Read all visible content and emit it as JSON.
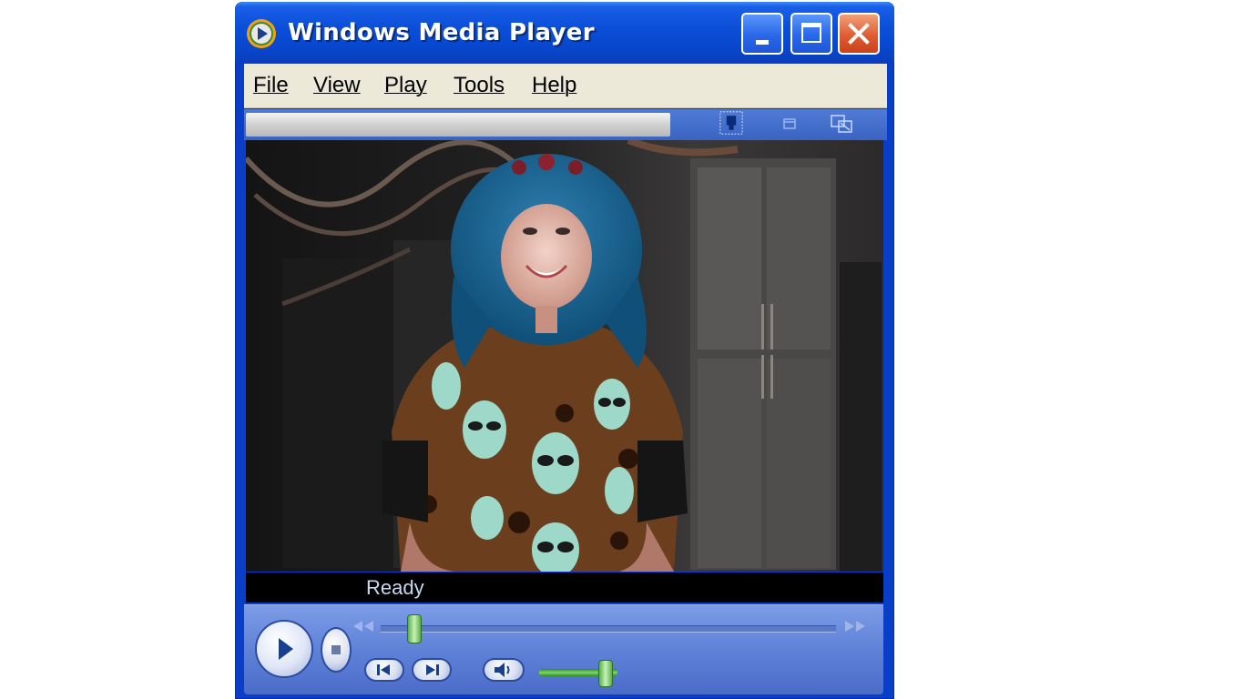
{
  "window": {
    "title": "Windows Media Player"
  },
  "menu": {
    "items": [
      {
        "label": "File"
      },
      {
        "label": "View"
      },
      {
        "label": "Play"
      },
      {
        "label": "Tools"
      },
      {
        "label": "Help"
      }
    ]
  },
  "status": {
    "text": "Ready"
  },
  "playback": {
    "seek_position_fraction": 0.06,
    "volume_fraction": 0.9
  },
  "icons": {
    "app": "wmp-logo-icon",
    "minimize": "minimize-icon",
    "maximize": "maximize-icon",
    "close": "close-icon",
    "play": "play-icon",
    "stop": "stop-icon",
    "previous": "previous-track-icon",
    "next": "next-track-icon",
    "mute": "speaker-icon",
    "rewind": "rewind-icon",
    "fast_forward": "fast-forward-icon"
  },
  "colors": {
    "title_bar": "#0a4ed8",
    "menu_bar": "#ece9d8",
    "close_button": "#e05c32",
    "controls": "#5f82d8",
    "slider_green": "#58b048"
  }
}
